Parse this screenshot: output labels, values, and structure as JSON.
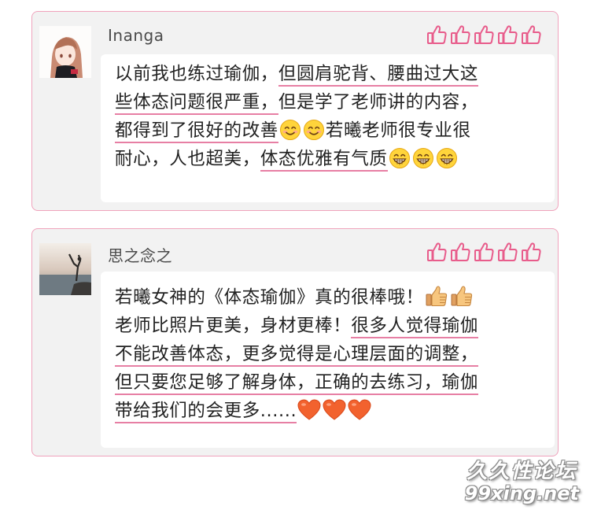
{
  "comments": [
    {
      "username": "Inanga",
      "likes": 5,
      "lines": [
        [
          "以前我也练过瑜伽，",
          {
            "hl": "但圆肩驼背、腰曲过大这"
          }
        ],
        [
          {
            "hl": "些体态问题很严重，"
          },
          "但是学了老师讲的内容，"
        ],
        [
          {
            "hl": "都得到了很好的改善"
          },
          {
            "emoji": "smile"
          },
          {
            "emoji": "smile"
          },
          "若曦老师很专业很"
        ],
        [
          "耐心，人也超美，",
          {
            "hl": "体态优雅有气质"
          },
          {
            "emoji": "grin"
          },
          {
            "emoji": "grin"
          },
          {
            "emoji": "grin"
          }
        ]
      ]
    },
    {
      "username": "思之念之",
      "likes": 5,
      "lines": [
        [
          "若曦女神的《体态瑜伽》真的很棒哦！",
          {
            "emoji": "thumbs-up"
          },
          {
            "emoji": "thumbs-up"
          }
        ],
        [
          "老师比照片更美，身材更棒！",
          {
            "hl": "很多人觉得瑜伽"
          }
        ],
        [
          {
            "hl": "不能改善体态，更多觉得是心理层面的调整，"
          }
        ],
        [
          {
            "hl": "但只要您足够了解身体，正确的去练习，瑜伽"
          }
        ],
        [
          {
            "hl": "带给我们的会更多......"
          },
          {
            "emoji": "heart"
          },
          {
            "emoji": "heart"
          },
          {
            "emoji": "heart"
          }
        ]
      ]
    }
  ],
  "watermark": {
    "line1": "久久性论坛",
    "line2": "99xing.net"
  },
  "colors": {
    "accent": "#e77fa4",
    "card_bg": "#f2f2f2",
    "border": "#f0a3bc"
  }
}
